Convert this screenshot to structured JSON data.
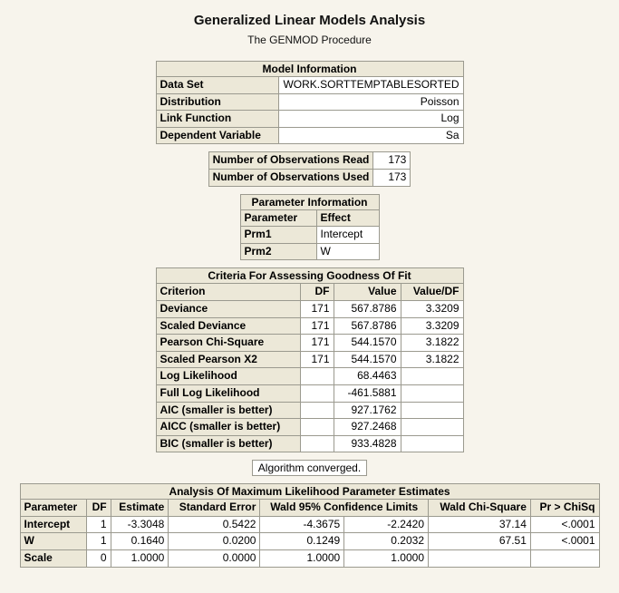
{
  "title": "Generalized Linear Models Analysis",
  "subtitle": "The GENMOD Procedure",
  "modelInfo": {
    "caption": "Model Information",
    "rows": [
      {
        "label": "Data Set",
        "value": "WORK.SORTTEMPTABLESORTED"
      },
      {
        "label": "Distribution",
        "value": "Poisson"
      },
      {
        "label": "Link Function",
        "value": "Log"
      },
      {
        "label": "Dependent Variable",
        "value": "Sa"
      }
    ]
  },
  "obs": {
    "readLabel": "Number of Observations Read",
    "readValue": "173",
    "usedLabel": "Number of Observations Used",
    "usedValue": "173"
  },
  "paramInfo": {
    "caption": "Parameter Information",
    "headers": [
      "Parameter",
      "Effect"
    ],
    "rows": [
      {
        "param": "Prm1",
        "effect": "Intercept"
      },
      {
        "param": "Prm2",
        "effect": "W"
      }
    ]
  },
  "fit": {
    "caption": "Criteria For Assessing Goodness Of Fit",
    "headers": [
      "Criterion",
      "DF",
      "Value",
      "Value/DF"
    ],
    "rows": [
      {
        "c": "Deviance",
        "df": "171",
        "v": "567.8786",
        "vdf": "3.3209"
      },
      {
        "c": "Scaled Deviance",
        "df": "171",
        "v": "567.8786",
        "vdf": "3.3209"
      },
      {
        "c": "Pearson Chi-Square",
        "df": "171",
        "v": "544.1570",
        "vdf": "3.1822"
      },
      {
        "c": "Scaled Pearson X2",
        "df": "171",
        "v": "544.1570",
        "vdf": "3.1822"
      },
      {
        "c": "Log Likelihood",
        "df": "",
        "v": "68.4463",
        "vdf": ""
      },
      {
        "c": "Full Log Likelihood",
        "df": "",
        "v": "-461.5881",
        "vdf": ""
      },
      {
        "c": "AIC (smaller is better)",
        "df": "",
        "v": "927.1762",
        "vdf": ""
      },
      {
        "c": "AICC (smaller is better)",
        "df": "",
        "v": "927.2468",
        "vdf": ""
      },
      {
        "c": "BIC (smaller is better)",
        "df": "",
        "v": "933.4828",
        "vdf": ""
      }
    ]
  },
  "convergedNote": "Algorithm converged.",
  "mle": {
    "caption": "Analysis Of Maximum Likelihood Parameter Estimates",
    "headers": [
      "Parameter",
      "DF",
      "Estimate",
      "Standard Error",
      "Wald 95% Confidence Limits",
      "Wald Chi-Square",
      "Pr > ChiSq"
    ],
    "rows": [
      {
        "p": "Intercept",
        "df": "1",
        "est": "-3.3048",
        "se": "0.5422",
        "lo": "-4.3675",
        "hi": "-2.2420",
        "chi": "37.14",
        "pr": "<.0001"
      },
      {
        "p": "W",
        "df": "1",
        "est": "0.1640",
        "se": "0.0200",
        "lo": "0.1249",
        "hi": "0.2032",
        "chi": "67.51",
        "pr": "<.0001"
      },
      {
        "p": "Scale",
        "df": "0",
        "est": "1.0000",
        "se": "0.0000",
        "lo": "1.0000",
        "hi": "1.0000",
        "chi": "",
        "pr": ""
      }
    ]
  }
}
